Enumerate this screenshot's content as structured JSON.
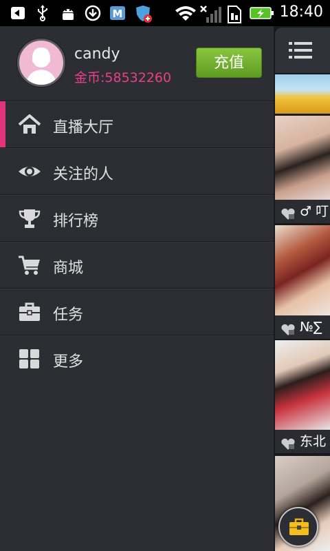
{
  "status_bar": {
    "time": "18:40",
    "icons": [
      "back-arrow-icon",
      "usb-icon",
      "android-debug-icon",
      "download-icon",
      "m-app-icon",
      "shield-app-icon",
      "wifi-icon",
      "no-signal-icon",
      "sim-icon",
      "battery-charging-icon"
    ]
  },
  "profile": {
    "username": "candy",
    "coins": "金币:58532260",
    "recharge_label": "充值"
  },
  "menu": [
    {
      "label": "直播大厅",
      "icon": "home-icon",
      "active": true
    },
    {
      "label": "关注的人",
      "icon": "eye-icon",
      "active": false
    },
    {
      "label": "排行榜",
      "icon": "trophy-icon",
      "active": false
    },
    {
      "label": "商城",
      "icon": "cart-icon",
      "active": false
    },
    {
      "label": "任务",
      "icon": "briefcase-icon",
      "active": false
    },
    {
      "label": "更多",
      "icon": "grid-icon",
      "active": false
    }
  ],
  "content": {
    "captions": [
      "♂ 叮",
      "№∑",
      "东北"
    ]
  },
  "colors": {
    "accent": "#e0357e",
    "coins": "#e93f8c",
    "recharge": "#6fae2c"
  }
}
